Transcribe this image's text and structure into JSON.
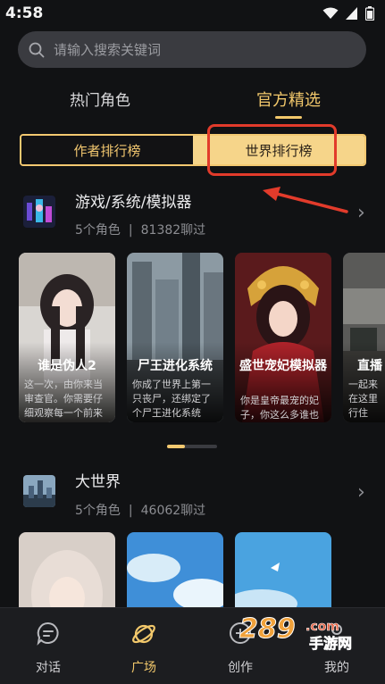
{
  "status_bar": {
    "time": "4:58"
  },
  "search": {
    "placeholder": "请输入搜索关键词"
  },
  "top_tabs": [
    {
      "label": "热门角色",
      "active": false
    },
    {
      "label": "官方精选",
      "active": true
    }
  ],
  "segment": {
    "left_label": "作者排行榜",
    "right_label": "世界排行榜",
    "selected": "世界排行榜"
  },
  "sections": [
    {
      "title": "游戏/系统/模拟器",
      "role_count": "5个角色",
      "chat_count": "81382聊过",
      "cards": [
        {
          "name": "谁是伪人2",
          "desc": "这一次，由你来当审查官。你需要仔细观察每一个前来"
        },
        {
          "name": "尸王进化系统",
          "desc": "你成了世界上第一只丧尸，还绑定了个尸王进化系统"
        },
        {
          "name": "盛世宠妃模拟器",
          "desc": "你是皇帝最宠的妃子，你这么多谁也斗"
        },
        {
          "name": "直播",
          "desc": "一起来在这里行住"
        }
      ]
    },
    {
      "title": "大世界",
      "role_count": "5个角色",
      "chat_count": "46062聊过"
    }
  ],
  "separator": "|",
  "bottom_nav": [
    {
      "label": "对话",
      "icon": "chat-bubble-icon",
      "active": false
    },
    {
      "label": "广场",
      "icon": "planet-icon",
      "active": true
    },
    {
      "label": "创作",
      "icon": "add-circle-icon",
      "active": false
    },
    {
      "label": "我的",
      "icon": "profile-icon",
      "active": false
    }
  ],
  "watermark": {
    "text": "289",
    "sub": "手游网"
  },
  "colors": {
    "accent": "#f2c86b",
    "background": "#111214",
    "highlight_box": "#e23b2b"
  }
}
